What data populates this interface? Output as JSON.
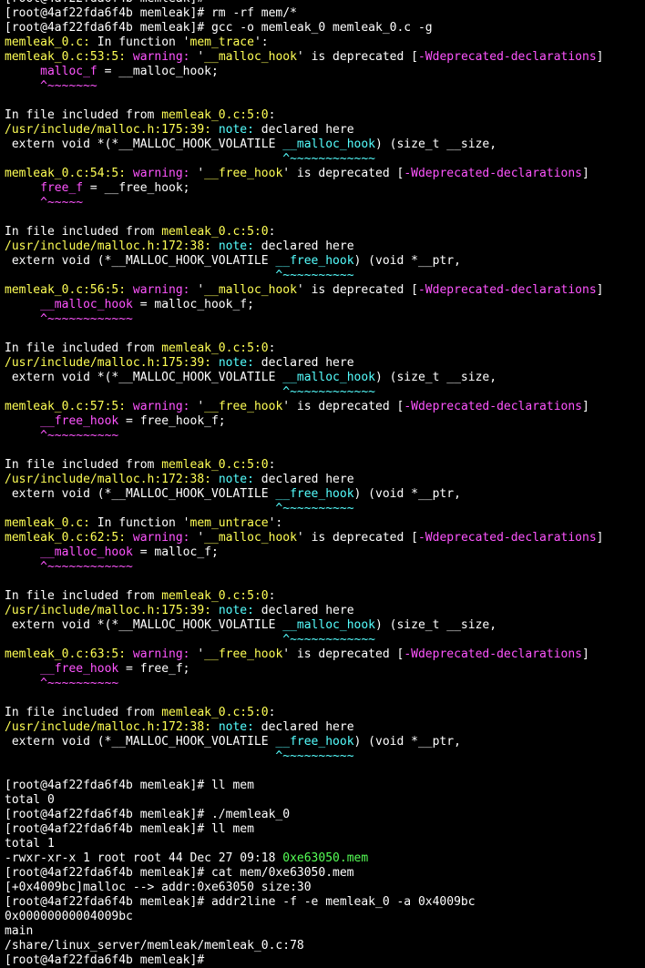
{
  "colors": {
    "default": "#ffffff",
    "yellow": "#ffff55",
    "magenta": "#ff55ff",
    "cyan": "#55ffff",
    "green": "#55ff55",
    "background": "#000000"
  },
  "terminal": {
    "lines": [
      [
        [
          "t",
          "[root@4af22fda6f4b memleak]# "
        ]
      ],
      [
        [
          "t",
          "[root@4af22fda6f4b memleak]# rm -rf mem/*"
        ]
      ],
      [
        [
          "t",
          "[root@4af22fda6f4b memleak]# gcc -o memleak_0 memleak_0.c -g"
        ]
      ],
      [
        [
          "y",
          "memleak_0.c:"
        ],
        [
          "t",
          " In function '"
        ],
        [
          "y",
          "mem_trace"
        ],
        [
          "t",
          "':"
        ]
      ],
      [
        [
          "y",
          "memleak_0.c:53:5:"
        ],
        [
          "t",
          " "
        ],
        [
          "m",
          "warning:"
        ],
        [
          "t",
          " '"
        ],
        [
          "y",
          "__malloc_hook"
        ],
        [
          "t",
          "' is deprecated ["
        ],
        [
          "m",
          "-Wdeprecated-declarations"
        ],
        [
          "t",
          "]"
        ]
      ],
      [
        [
          "t",
          "     "
        ],
        [
          "m",
          "malloc_f"
        ],
        [
          "t",
          " = __malloc_hook;"
        ]
      ],
      [
        [
          "t",
          "     "
        ],
        [
          "m",
          "^~~~~~~~"
        ]
      ],
      [
        [
          "t",
          ""
        ]
      ],
      [
        [
          "t",
          "In file included from "
        ],
        [
          "y",
          "memleak_0.c:5:0"
        ],
        [
          "t",
          ":"
        ]
      ],
      [
        [
          "y",
          "/usr/include/malloc.h:175:39:"
        ],
        [
          "t",
          " "
        ],
        [
          "c",
          "note:"
        ],
        [
          "t",
          " declared here"
        ]
      ],
      [
        [
          "t",
          " extern void *(*__MALLOC_HOOK_VOLATILE "
        ],
        [
          "c",
          "__malloc_hook"
        ],
        [
          "t",
          ") (size_t __size,"
        ]
      ],
      [
        [
          "t",
          "                                       "
        ],
        [
          "c",
          "^~~~~~~~~~~~~"
        ]
      ],
      [
        [
          "y",
          "memleak_0.c:54:5:"
        ],
        [
          "t",
          " "
        ],
        [
          "m",
          "warning:"
        ],
        [
          "t",
          " '"
        ],
        [
          "y",
          "__free_hook"
        ],
        [
          "t",
          "' is deprecated ["
        ],
        [
          "m",
          "-Wdeprecated-declarations"
        ],
        [
          "t",
          "]"
        ]
      ],
      [
        [
          "t",
          "     "
        ],
        [
          "m",
          "free_f"
        ],
        [
          "t",
          " = __free_hook;"
        ]
      ],
      [
        [
          "t",
          "     "
        ],
        [
          "m",
          "^~~~~~"
        ]
      ],
      [
        [
          "t",
          ""
        ]
      ],
      [
        [
          "t",
          "In file included from "
        ],
        [
          "y",
          "memleak_0.c:5:0"
        ],
        [
          "t",
          ":"
        ]
      ],
      [
        [
          "y",
          "/usr/include/malloc.h:172:38:"
        ],
        [
          "t",
          " "
        ],
        [
          "c",
          "note:"
        ],
        [
          "t",
          " declared here"
        ]
      ],
      [
        [
          "t",
          " extern void (*__MALLOC_HOOK_VOLATILE "
        ],
        [
          "c",
          "__free_hook"
        ],
        [
          "t",
          ") (void *__ptr,"
        ]
      ],
      [
        [
          "t",
          "                                      "
        ],
        [
          "c",
          "^~~~~~~~~~~"
        ]
      ],
      [
        [
          "y",
          "memleak_0.c:56:5:"
        ],
        [
          "t",
          " "
        ],
        [
          "m",
          "warning:"
        ],
        [
          "t",
          " '"
        ],
        [
          "y",
          "__malloc_hook"
        ],
        [
          "t",
          "' is deprecated ["
        ],
        [
          "m",
          "-Wdeprecated-declarations"
        ],
        [
          "t",
          "]"
        ]
      ],
      [
        [
          "t",
          "     "
        ],
        [
          "m",
          "__malloc_hook"
        ],
        [
          "t",
          " = malloc_hook_f;"
        ]
      ],
      [
        [
          "t",
          "     "
        ],
        [
          "m",
          "^~~~~~~~~~~~~"
        ]
      ],
      [
        [
          "t",
          ""
        ]
      ],
      [
        [
          "t",
          "In file included from "
        ],
        [
          "y",
          "memleak_0.c:5:0"
        ],
        [
          "t",
          ":"
        ]
      ],
      [
        [
          "y",
          "/usr/include/malloc.h:175:39:"
        ],
        [
          "t",
          " "
        ],
        [
          "c",
          "note:"
        ],
        [
          "t",
          " declared here"
        ]
      ],
      [
        [
          "t",
          " extern void *(*__MALLOC_HOOK_VOLATILE "
        ],
        [
          "c",
          "__malloc_hook"
        ],
        [
          "t",
          ") (size_t __size,"
        ]
      ],
      [
        [
          "t",
          "                                       "
        ],
        [
          "c",
          "^~~~~~~~~~~~~"
        ]
      ],
      [
        [
          "y",
          "memleak_0.c:57:5:"
        ],
        [
          "t",
          " "
        ],
        [
          "m",
          "warning:"
        ],
        [
          "t",
          " '"
        ],
        [
          "y",
          "__free_hook"
        ],
        [
          "t",
          "' is deprecated ["
        ],
        [
          "m",
          "-Wdeprecated-declarations"
        ],
        [
          "t",
          "]"
        ]
      ],
      [
        [
          "t",
          "     "
        ],
        [
          "m",
          "__free_hook"
        ],
        [
          "t",
          " = free_hook_f;"
        ]
      ],
      [
        [
          "t",
          "     "
        ],
        [
          "m",
          "^~~~~~~~~~~"
        ]
      ],
      [
        [
          "t",
          ""
        ]
      ],
      [
        [
          "t",
          "In file included from "
        ],
        [
          "y",
          "memleak_0.c:5:0"
        ],
        [
          "t",
          ":"
        ]
      ],
      [
        [
          "y",
          "/usr/include/malloc.h:172:38:"
        ],
        [
          "t",
          " "
        ],
        [
          "c",
          "note:"
        ],
        [
          "t",
          " declared here"
        ]
      ],
      [
        [
          "t",
          " extern void (*__MALLOC_HOOK_VOLATILE "
        ],
        [
          "c",
          "__free_hook"
        ],
        [
          "t",
          ") (void *__ptr,"
        ]
      ],
      [
        [
          "t",
          "                                      "
        ],
        [
          "c",
          "^~~~~~~~~~~"
        ]
      ],
      [
        [
          "y",
          "memleak_0.c:"
        ],
        [
          "t",
          " In function '"
        ],
        [
          "y",
          "mem_untrace"
        ],
        [
          "t",
          "':"
        ]
      ],
      [
        [
          "y",
          "memleak_0.c:62:5:"
        ],
        [
          "t",
          " "
        ],
        [
          "m",
          "warning:"
        ],
        [
          "t",
          " '"
        ],
        [
          "y",
          "__malloc_hook"
        ],
        [
          "t",
          "' is deprecated ["
        ],
        [
          "m",
          "-Wdeprecated-declarations"
        ],
        [
          "t",
          "]"
        ]
      ],
      [
        [
          "t",
          "     "
        ],
        [
          "m",
          "__malloc_hook"
        ],
        [
          "t",
          " = malloc_f;"
        ]
      ],
      [
        [
          "t",
          "     "
        ],
        [
          "m",
          "^~~~~~~~~~~~~"
        ]
      ],
      [
        [
          "t",
          ""
        ]
      ],
      [
        [
          "t",
          "In file included from "
        ],
        [
          "y",
          "memleak_0.c:5:0"
        ],
        [
          "t",
          ":"
        ]
      ],
      [
        [
          "y",
          "/usr/include/malloc.h:175:39:"
        ],
        [
          "t",
          " "
        ],
        [
          "c",
          "note:"
        ],
        [
          "t",
          " declared here"
        ]
      ],
      [
        [
          "t",
          " extern void *(*__MALLOC_HOOK_VOLATILE "
        ],
        [
          "c",
          "__malloc_hook"
        ],
        [
          "t",
          ") (size_t __size,"
        ]
      ],
      [
        [
          "t",
          "                                       "
        ],
        [
          "c",
          "^~~~~~~~~~~~~"
        ]
      ],
      [
        [
          "y",
          "memleak_0.c:63:5:"
        ],
        [
          "t",
          " "
        ],
        [
          "m",
          "warning:"
        ],
        [
          "t",
          " '"
        ],
        [
          "y",
          "__free_hook"
        ],
        [
          "t",
          "' is deprecated ["
        ],
        [
          "m",
          "-Wdeprecated-declarations"
        ],
        [
          "t",
          "]"
        ]
      ],
      [
        [
          "t",
          "     "
        ],
        [
          "m",
          "__free_hook"
        ],
        [
          "t",
          " = free_f;"
        ]
      ],
      [
        [
          "t",
          "     "
        ],
        [
          "m",
          "^~~~~~~~~~~"
        ]
      ],
      [
        [
          "t",
          ""
        ]
      ],
      [
        [
          "t",
          "In file included from "
        ],
        [
          "y",
          "memleak_0.c:5:0"
        ],
        [
          "t",
          ":"
        ]
      ],
      [
        [
          "y",
          "/usr/include/malloc.h:172:38:"
        ],
        [
          "t",
          " "
        ],
        [
          "c",
          "note:"
        ],
        [
          "t",
          " declared here"
        ]
      ],
      [
        [
          "t",
          " extern void (*__MALLOC_HOOK_VOLATILE "
        ],
        [
          "c",
          "__free_hook"
        ],
        [
          "t",
          ") (void *__ptr,"
        ]
      ],
      [
        [
          "t",
          "                                      "
        ],
        [
          "c",
          "^~~~~~~~~~~"
        ]
      ],
      [
        [
          "t",
          ""
        ]
      ],
      [
        [
          "t",
          "[root@4af22fda6f4b memleak]# ll mem"
        ]
      ],
      [
        [
          "t",
          "total 0"
        ]
      ],
      [
        [
          "t",
          "[root@4af22fda6f4b memleak]# ./memleak_0"
        ]
      ],
      [
        [
          "t",
          "[root@4af22fda6f4b memleak]# ll mem"
        ]
      ],
      [
        [
          "t",
          "total 1"
        ]
      ],
      [
        [
          "t",
          "-rwxr-xr-x 1 root root 44 Dec 27 09:18 "
        ],
        [
          "g",
          "0xe63050.mem"
        ]
      ],
      [
        [
          "t",
          "[root@4af22fda6f4b memleak]# cat mem/0xe63050.mem"
        ]
      ],
      [
        [
          "t",
          "[+0x4009bc]malloc --> addr:0xe63050 size:30"
        ]
      ],
      [
        [
          "t",
          "[root@4af22fda6f4b memleak]# addr2line -f -e memleak_0 -a 0x4009bc"
        ]
      ],
      [
        [
          "t",
          "0x00000000004009bc"
        ]
      ],
      [
        [
          "t",
          "main"
        ]
      ],
      [
        [
          "t",
          "/share/linux_server/memleak/memleak_0.c:78"
        ]
      ],
      [
        [
          "t",
          "[root@4af22fda6f4b memleak]# "
        ]
      ]
    ]
  }
}
